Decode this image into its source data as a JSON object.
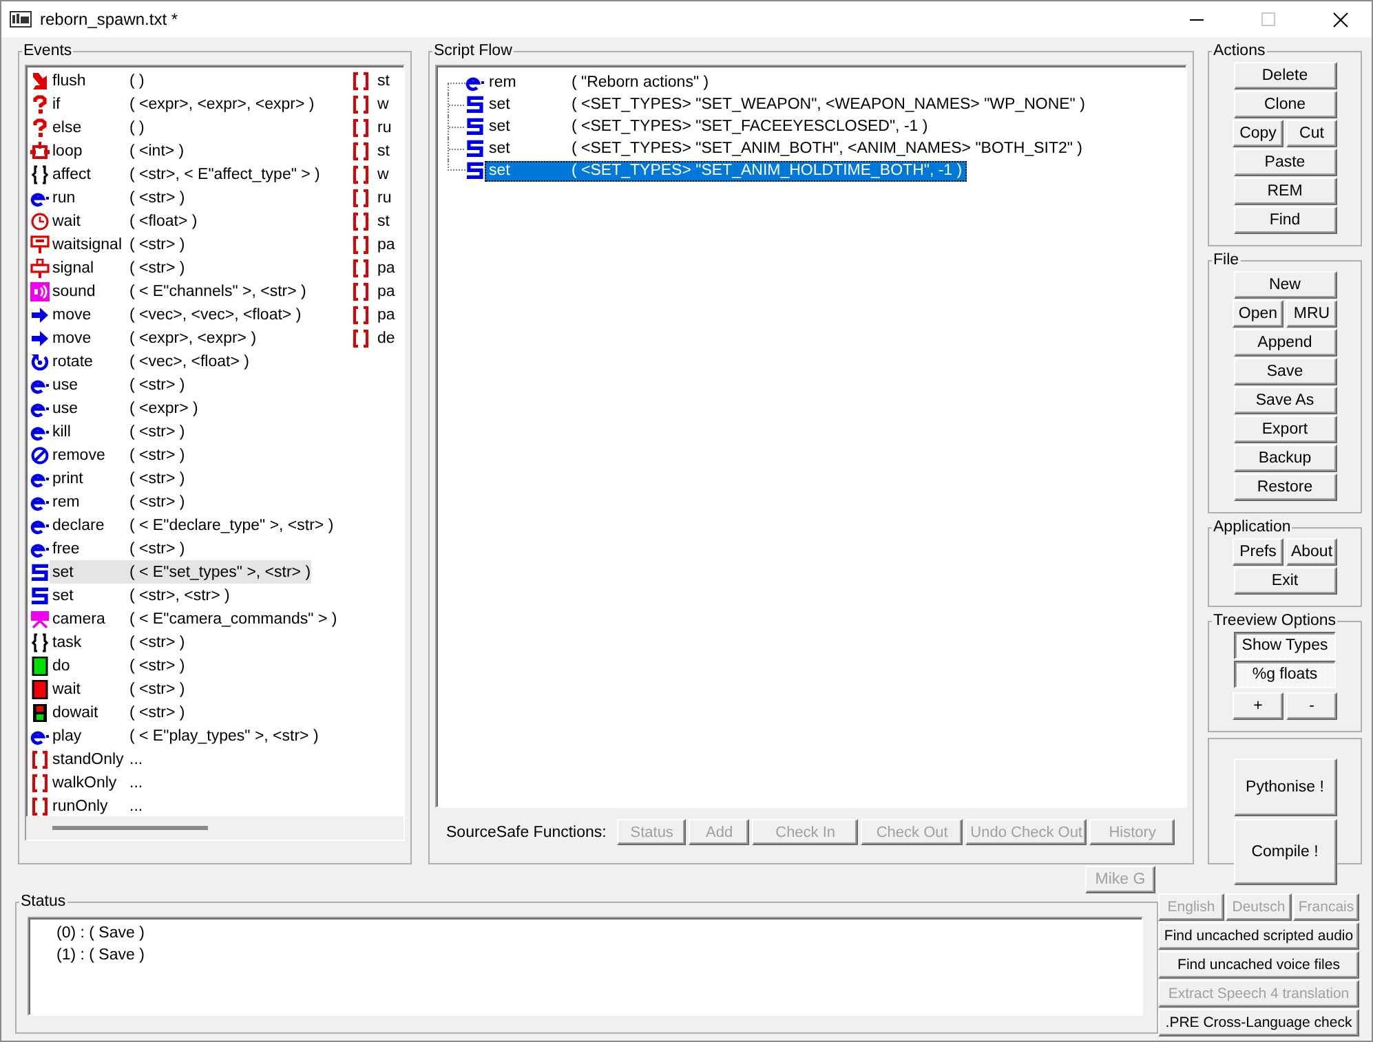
{
  "window": {
    "title": "reborn_spawn.txt *"
  },
  "events": {
    "title": "Events",
    "items": [
      {
        "kind": "flush",
        "name": "flush",
        "args": "(    )",
        "selected": false
      },
      {
        "kind": "question",
        "name": "if",
        "args": "(  <expr>, <expr>, <expr>  )",
        "selected": false
      },
      {
        "kind": "question",
        "name": "else",
        "args": "(    )",
        "selected": false
      },
      {
        "kind": "loop",
        "name": "loop",
        "args": "(  <int>  )",
        "selected": false
      },
      {
        "kind": "braces",
        "name": "affect",
        "args": "(  <str>, < E\"affect_type\" >  )",
        "selected": false
      },
      {
        "kind": "e",
        "name": "run",
        "args": "(  <str>  )",
        "selected": false
      },
      {
        "kind": "clock",
        "name": "wait",
        "args": "(  <float>  )",
        "selected": false
      },
      {
        "kind": "waitsignal",
        "name": "waitsignal",
        "args": "(  <str>  )",
        "selected": false
      },
      {
        "kind": "signal",
        "name": "signal",
        "args": "(  <str>  )",
        "selected": false
      },
      {
        "kind": "sound",
        "name": "sound",
        "args": "(  < E\"channels\" >, <str>  )",
        "selected": false
      },
      {
        "kind": "arrow",
        "name": "move",
        "args": "(  <vec>, <vec>, <float>  )",
        "selected": false
      },
      {
        "kind": "arrow",
        "name": "move",
        "args": "(  <expr>, <expr>  )",
        "selected": false
      },
      {
        "kind": "rotate",
        "name": "rotate",
        "args": "(  <vec>, <float>  )",
        "selected": false
      },
      {
        "kind": "e",
        "name": "use",
        "args": "(  <str>  )",
        "selected": false
      },
      {
        "kind": "e",
        "name": "use",
        "args": "(  <expr>  )",
        "selected": false
      },
      {
        "kind": "e",
        "name": "kill",
        "args": "(  <str>  )",
        "selected": false
      },
      {
        "kind": "remove",
        "name": "remove",
        "args": "(  <str>  )",
        "selected": false
      },
      {
        "kind": "e",
        "name": "print",
        "args": "(  <str>  )",
        "selected": false
      },
      {
        "kind": "e",
        "name": "rem",
        "args": "(  <str>  )",
        "selected": false
      },
      {
        "kind": "e",
        "name": "declare",
        "args": "(  < E\"declare_type\" >, <str>  )",
        "selected": false
      },
      {
        "kind": "e",
        "name": "free",
        "args": "(  <str>  )",
        "selected": false
      },
      {
        "kind": "s",
        "name": "set",
        "args": "(  < E\"set_types\" >, <str>  )",
        "selected": true
      },
      {
        "kind": "s",
        "name": "set",
        "args": "(  <str>, <str>  )",
        "selected": false
      },
      {
        "kind": "camera",
        "name": "camera",
        "args": "(  < E\"camera_commands\" >  )",
        "selected": false
      },
      {
        "kind": "braces",
        "name": "task",
        "args": "(  <str>  )",
        "selected": false
      },
      {
        "kind": "go",
        "name": "do",
        "args": "(  <str>  )",
        "selected": false
      },
      {
        "kind": "stop",
        "name": "wait",
        "args": "(  <str>  )",
        "selected": false
      },
      {
        "kind": "stopgo",
        "name": "dowait",
        "args": "(  <str>  )",
        "selected": false
      },
      {
        "kind": "e",
        "name": "play",
        "args": "(  < E\"play_types\" >, <str>  )",
        "selected": false
      },
      {
        "kind": "brackets",
        "name": "standOnly",
        "args": "...",
        "selected": false
      },
      {
        "kind": "brackets",
        "name": "walkOnly",
        "args": "...",
        "selected": false
      },
      {
        "kind": "brackets",
        "name": "runOnly",
        "args": "...",
        "selected": false
      }
    ],
    "column_2": [
      {
        "kind": "brackets",
        "name": "st"
      },
      {
        "kind": "brackets",
        "name": "w"
      },
      {
        "kind": "brackets",
        "name": "ru"
      },
      {
        "kind": "brackets",
        "name": "st"
      },
      {
        "kind": "brackets",
        "name": "w"
      },
      {
        "kind": "brackets",
        "name": "ru"
      },
      {
        "kind": "brackets",
        "name": "st"
      },
      {
        "kind": "brackets",
        "name": "pa"
      },
      {
        "kind": "brackets",
        "name": "pa"
      },
      {
        "kind": "brackets",
        "name": "pa"
      },
      {
        "kind": "brackets",
        "name": "pa"
      },
      {
        "kind": "brackets",
        "name": "de"
      }
    ]
  },
  "script_flow": {
    "title": "Script Flow",
    "items": [
      {
        "kind": "e",
        "name": "rem",
        "args": "(  \"Reborn actions\"  )",
        "selected": false
      },
      {
        "kind": "s",
        "name": "set",
        "args": "(  <SET_TYPES> \"SET_WEAPON\", <WEAPON_NAMES> \"WP_NONE\"  )",
        "selected": false
      },
      {
        "kind": "s",
        "name": "set",
        "args": "(  <SET_TYPES> \"SET_FACEEYESCLOSED\", -1  )",
        "selected": false
      },
      {
        "kind": "s",
        "name": "set",
        "args": "(  <SET_TYPES> \"SET_ANIM_BOTH\", <ANIM_NAMES> \"BOTH_SIT2\"  )",
        "selected": false
      },
      {
        "kind": "s",
        "name": "set",
        "args": "(  <SET_TYPES> \"SET_ANIM_HOLDTIME_BOTH\", -1  )",
        "selected": true
      }
    ],
    "sourcesafe": {
      "label": "SourceSafe Functions:",
      "buttons": [
        {
          "label": "Status",
          "disabled": true
        },
        {
          "label": "Add",
          "disabled": true
        },
        {
          "label": "Check In",
          "disabled": true
        },
        {
          "label": "Check Out",
          "disabled": true
        },
        {
          "label": "Undo Check Out",
          "disabled": true
        },
        {
          "label": "History",
          "disabled": true
        }
      ]
    }
  },
  "actions": {
    "title": "Actions",
    "rows": [
      [
        {
          "label": "Delete"
        }
      ],
      [
        {
          "label": "Clone"
        }
      ],
      [
        {
          "label": "Copy"
        },
        {
          "label": "Cut"
        }
      ],
      [
        {
          "label": "Paste"
        }
      ],
      [
        {
          "label": "REM"
        }
      ],
      [
        {
          "label": "Find"
        }
      ]
    ]
  },
  "file": {
    "title": "File",
    "rows": [
      [
        {
          "label": "New"
        }
      ],
      [
        {
          "label": "Open"
        },
        {
          "label": "MRU"
        }
      ],
      [
        {
          "label": "Append"
        }
      ],
      [
        {
          "label": "Save"
        }
      ],
      [
        {
          "label": "Save As"
        }
      ],
      [
        {
          "label": "Export"
        }
      ],
      [
        {
          "label": "Backup"
        }
      ],
      [
        {
          "label": "Restore"
        }
      ]
    ]
  },
  "application": {
    "title": "Application",
    "rows": [
      [
        {
          "label": "Prefs"
        },
        {
          "label": "About"
        }
      ],
      [
        {
          "label": "Exit"
        }
      ]
    ]
  },
  "treeview_options": {
    "title": "Treeview Options",
    "toggles": [
      {
        "label": "Show Types",
        "pressed": true
      },
      {
        "label": "%g floats",
        "pressed": true
      }
    ],
    "buttons": [
      {
        "label": "+"
      },
      {
        "label": "-"
      }
    ]
  },
  "build": {
    "buttons": [
      {
        "label": "Pythonise !"
      },
      {
        "label": "Compile !"
      }
    ]
  },
  "user_button": {
    "label": "Mike G",
    "disabled": true
  },
  "status": {
    "title": "Status",
    "lines": [
      "(0) : ( Save )",
      "(1) : ( Save )"
    ]
  },
  "languages": [
    {
      "label": "English",
      "disabled": true
    },
    {
      "label": "Deutsch",
      "disabled": true
    },
    {
      "label": "Francais",
      "disabled": true
    }
  ],
  "tools": [
    {
      "label": "Find uncached scripted audio",
      "disabled": false
    },
    {
      "label": "Find uncached voice files",
      "disabled": false
    },
    {
      "label": "Extract Speech 4 translation",
      "disabled": true
    },
    {
      "label": ".PRE Cross-Language check",
      "disabled": false
    }
  ]
}
